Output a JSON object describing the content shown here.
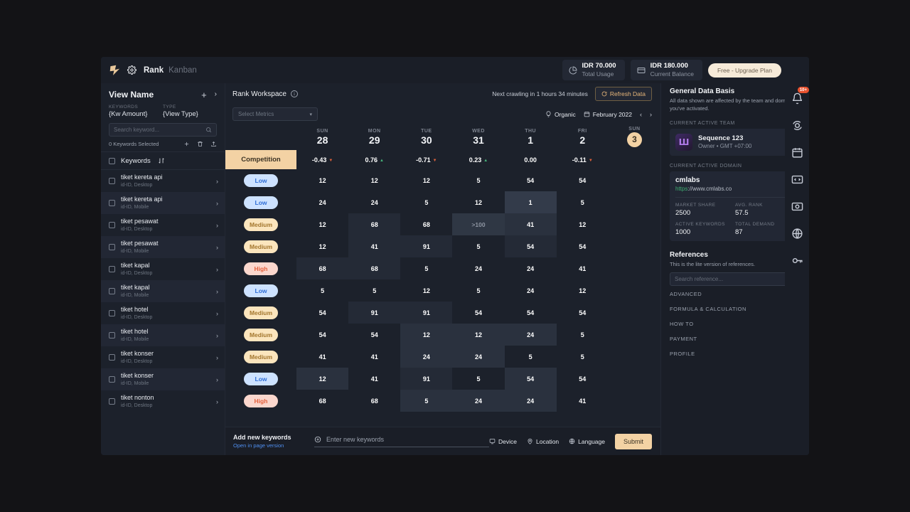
{
  "topbar": {
    "brand_main": "Rank",
    "brand_sub": "Kanban",
    "usage_value": "IDR 70.000",
    "usage_label": "Total Usage",
    "balance_value": "IDR 180.000",
    "balance_label": "Current Balance",
    "upgrade_label": "Free - Upgrade Plan"
  },
  "left": {
    "title": "View Name",
    "meta_keywords_label": "KEYWORDS",
    "meta_keywords_value": "{Kw Amount}",
    "meta_type_label": "TYPE",
    "meta_type_value": "{View Type}",
    "search_placeholder": "Search keyword...",
    "selected_text": "0 Keywords Selected",
    "col_header": "Keywords"
  },
  "workspace": {
    "title": "Rank Workspace",
    "crawl_text": "Next crawling in 1 hours 34 minutes",
    "refresh_label": "Refresh Data",
    "metrics_placeholder": "Select Metrics",
    "organic_label": "Organic",
    "month_label": "February 2022",
    "prev_arrow": "‹",
    "next_arrow": "›"
  },
  "grid": {
    "competition_header": "Competition",
    "days": [
      {
        "dow": "SUN",
        "num": "28",
        "today": false
      },
      {
        "dow": "MON",
        "num": "29",
        "today": false
      },
      {
        "dow": "TUE",
        "num": "30",
        "today": false
      },
      {
        "dow": "WED",
        "num": "31",
        "today": false
      },
      {
        "dow": "THU",
        "num": "1",
        "today": false
      },
      {
        "dow": "FRI",
        "num": "2",
        "today": false
      },
      {
        "dow": "SUN",
        "num": "3",
        "today": true
      }
    ],
    "metric_row": [
      {
        "value": "-0.43",
        "dir": "down"
      },
      {
        "value": "0.76",
        "dir": "up"
      },
      {
        "value": "-0.71",
        "dir": "down"
      },
      {
        "value": "0.23",
        "dir": "up"
      },
      {
        "value": "0.00",
        "dir": "none"
      },
      {
        "value": "-0.11",
        "dir": "down"
      }
    ],
    "rows": [
      {
        "keyword": "tiket kereta api",
        "sub": "id-ID, Desktop",
        "competition": "Low",
        "comp_class": "low",
        "alt": false,
        "values": [
          "12",
          "12",
          "12",
          "5",
          "54",
          "54"
        ],
        "hl": [
          "",
          "",
          "",
          "",
          "",
          ""
        ]
      },
      {
        "keyword": "tiket kereta api",
        "sub": "id-ID, Mobile",
        "competition": "Low",
        "comp_class": "low",
        "alt": true,
        "values": [
          "24",
          "24",
          "5",
          "12",
          "1",
          "5"
        ],
        "hl": [
          "",
          "",
          "",
          "",
          "h3",
          ""
        ]
      },
      {
        "keyword": "tiket pesawat",
        "sub": "id-ID, Desktop",
        "competition": "Medium",
        "comp_class": "med",
        "alt": false,
        "values": [
          "12",
          "68",
          "68",
          ">100",
          "41",
          "12"
        ],
        "hl": [
          "",
          "h1",
          "",
          "over",
          "h2",
          ""
        ]
      },
      {
        "keyword": "tiket pesawat",
        "sub": "id-ID, Mobile",
        "competition": "Medium",
        "comp_class": "med",
        "alt": true,
        "values": [
          "12",
          "41",
          "91",
          "5",
          "54",
          "54"
        ],
        "hl": [
          "",
          "h1",
          "h1",
          "",
          "h1",
          ""
        ]
      },
      {
        "keyword": "tiket kapal",
        "sub": "id-ID, Desktop",
        "competition": "High",
        "comp_class": "high",
        "alt": false,
        "values": [
          "68",
          "68",
          "5",
          "24",
          "24",
          "41"
        ],
        "hl": [
          "h1",
          "h1",
          "",
          "",
          "",
          ""
        ]
      },
      {
        "keyword": "tiket kapal",
        "sub": "id-ID, Mobile",
        "competition": "Low",
        "comp_class": "low",
        "alt": true,
        "values": [
          "5",
          "5",
          "12",
          "5",
          "24",
          "12"
        ],
        "hl": [
          "",
          "",
          "",
          "",
          "",
          ""
        ]
      },
      {
        "keyword": "tiket hotel",
        "sub": "id-ID, Desktop",
        "competition": "Medium",
        "comp_class": "med",
        "alt": false,
        "values": [
          "54",
          "91",
          "91",
          "54",
          "54",
          "54"
        ],
        "hl": [
          "",
          "h1",
          "h1",
          "",
          "",
          ""
        ]
      },
      {
        "keyword": "tiket hotel",
        "sub": "id-ID, Mobile",
        "competition": "Medium",
        "comp_class": "med",
        "alt": true,
        "values": [
          "54",
          "54",
          "12",
          "12",
          "24",
          "5"
        ],
        "hl": [
          "",
          "",
          "h2",
          "h2",
          "h2",
          ""
        ]
      },
      {
        "keyword": "tiket konser",
        "sub": "id-ID, Desktop",
        "competition": "Medium",
        "comp_class": "med",
        "alt": false,
        "values": [
          "41",
          "41",
          "24",
          "24",
          "5",
          "5"
        ],
        "hl": [
          "",
          "",
          "h2",
          "h2",
          "",
          ""
        ]
      },
      {
        "keyword": "tiket konser",
        "sub": "id-ID, Mobile",
        "competition": "Low",
        "comp_class": "low",
        "alt": true,
        "values": [
          "12",
          "41",
          "91",
          "5",
          "54",
          "54"
        ],
        "hl": [
          "h2",
          "",
          "h1",
          "",
          "h2",
          ""
        ]
      },
      {
        "keyword": "tiket nonton",
        "sub": "id-ID, Desktop",
        "competition": "High",
        "comp_class": "high",
        "alt": false,
        "values": [
          "68",
          "68",
          "5",
          "24",
          "24",
          "41"
        ],
        "hl": [
          "",
          "",
          "h2",
          "h2",
          "h2",
          ""
        ]
      }
    ]
  },
  "bottom": {
    "title": "Add new keywords",
    "link": "Open in page version",
    "input_placeholder": "Enter new keywords",
    "device_label": "Device",
    "location_label": "Location",
    "language_label": "Language",
    "submit_label": "Submit"
  },
  "right": {
    "heading": "General Data Basis",
    "description": "All data shown are affected by the team and domain you've activated.",
    "team_label": "CURRENT ACTIVE TEAM",
    "team_name": "Sequence 123",
    "team_sub": "Owner • GMT +07:00",
    "team_initial": "Ш",
    "domain_label": "CURRENT ACTIVE DOMAIN",
    "domain_name": "cmlabs",
    "domain_url_secure": "https",
    "domain_url_rest": "://www.cmlabs.co",
    "domain_stats": [
      {
        "key": "MARKET SHARE",
        "value": "2500"
      },
      {
        "key": "AVG. RANK",
        "value": "57.5"
      },
      {
        "key": "ACTIVE KEYWORDS",
        "value": "1000"
      },
      {
        "key": "TOTAL DEMAND",
        "value": "87"
      }
    ],
    "references_heading": "References",
    "references_desc": "This is the lite version of references.",
    "references_placeholder": "Search reference...",
    "accordions": [
      "ADVANCED",
      "FORMULA & CALCULATION",
      "HOW TO",
      "PAYMENT",
      "PROFILE"
    ]
  },
  "rail": {
    "notification_badge": "10+"
  }
}
